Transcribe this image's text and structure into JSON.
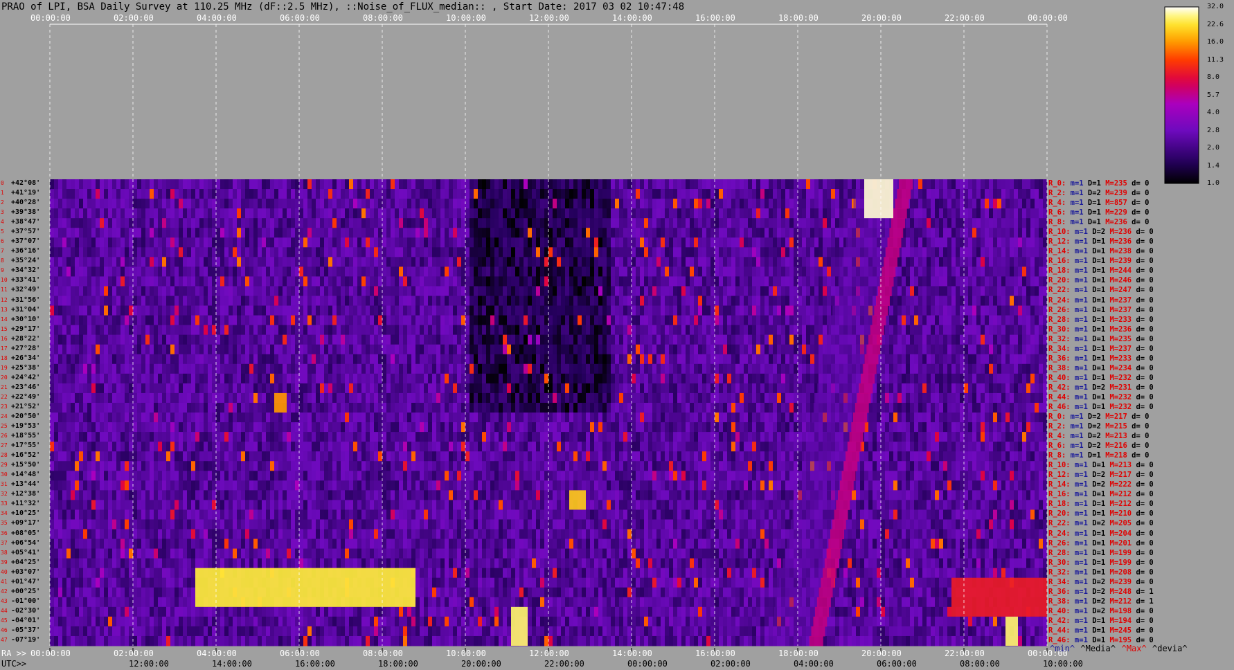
{
  "chart_data": {
    "type": "heatmap",
    "title": "PRAO of LPI, BSA Daily Survey at 110.25 MHz (dF::2.5 MHz), ::Noise_of_FLUX_median:: , Start Date: 2017 03 02 10:47:48",
    "top_ticks": [
      "00:00:00",
      "02:00:00",
      "04:00:00",
      "06:00:00",
      "08:00:00",
      "10:00:00",
      "12:00:00",
      "14:00:00",
      "16:00:00",
      "18:00:00",
      "20:00:00",
      "22:00:00",
      "00:00:00"
    ],
    "ra_label": "RA >>",
    "ra_ticks": [
      "00:00:00",
      "02:00:00",
      "04:00:00",
      "06:00:00",
      "08:00:00",
      "10:00:00",
      "12:00:00",
      "14:00:00",
      "16:00:00",
      "18:00:00",
      "20:00:00",
      "22:00:00",
      "00:00:00"
    ],
    "utc_label": "UTC>>",
    "utc_ticks": [
      "12:00:00",
      "14:00:00",
      "16:00:00",
      "18:00:00",
      "20:00:00",
      "22:00:00",
      "00:00:00",
      "02:00:00",
      "04:00:00",
      "06:00:00",
      "08:00:00",
      "10:00:00"
    ],
    "declinations": [
      "+42°08'",
      "+41°19'",
      "+40°28'",
      "+39°38'",
      "+38°47'",
      "+37°57'",
      "+37°07'",
      "+36°16'",
      "+35°24'",
      "+34°32'",
      "+33°41'",
      "+32°49'",
      "+31°56'",
      "+31°04'",
      "+30°10'",
      "+29°17'",
      "+28°22'",
      "+27°28'",
      "+26°34'",
      "+25°38'",
      "+24°42'",
      "+23°46'",
      "+22°49'",
      "+21°52'",
      "+20°50'",
      "+19°53'",
      "+18°55'",
      "+17°55'",
      "+16°52'",
      "+15°50'",
      "+14°48'",
      "+13°44'",
      "+12°38'",
      "+11°32'",
      "+10°25'",
      "+09°17'",
      "+08°05'",
      "+06°54'",
      "+05°41'",
      "+04°25'",
      "+03°07'",
      "+01°47'",
      "+00°25'",
      "-01°00'",
      "-02°30'",
      "-04°01'",
      "-05°37'",
      "-07°19'"
    ],
    "stats": [
      {
        "label": "R_0:",
        "m": "m=1",
        "D": "D=1",
        "M": "M=235",
        "d": "d= 0"
      },
      {
        "label": "R_2:",
        "m": "m=1",
        "D": "D=2",
        "M": "M=239",
        "d": "d= 0"
      },
      {
        "label": "R_4:",
        "m": "m=1",
        "D": "D=1",
        "M": "M=857",
        "d": "d= 0"
      },
      {
        "label": "R_6:",
        "m": "m=1",
        "D": "D=1",
        "M": "M=229",
        "d": "d= 0"
      },
      {
        "label": "R_8:",
        "m": "m=1",
        "D": "D=1",
        "M": "M=236",
        "d": "d= 0"
      },
      {
        "label": "R_10:",
        "m": "m=1",
        "D": "D=2",
        "M": "M=236",
        "d": "d= 0"
      },
      {
        "label": "R_12:",
        "m": "m=1",
        "D": "D=1",
        "M": "M=236",
        "d": "d= 0"
      },
      {
        "label": "R_14:",
        "m": "m=1",
        "D": "D=1",
        "M": "M=238",
        "d": "d= 0"
      },
      {
        "label": "R_16:",
        "m": "m=1",
        "D": "D=1",
        "M": "M=239",
        "d": "d= 0"
      },
      {
        "label": "R_18:",
        "m": "m=1",
        "D": "D=1",
        "M": "M=244",
        "d": "d= 0"
      },
      {
        "label": "R_20:",
        "m": "m=1",
        "D": "D=1",
        "M": "M=246",
        "d": "d= 0"
      },
      {
        "label": "R_22:",
        "m": "m=1",
        "D": "D=1",
        "M": "M=247",
        "d": "d= 0"
      },
      {
        "label": "R_24:",
        "m": "m=1",
        "D": "D=1",
        "M": "M=237",
        "d": "d= 0"
      },
      {
        "label": "R_26:",
        "m": "m=1",
        "D": "D=1",
        "M": "M=237",
        "d": "d= 0"
      },
      {
        "label": "R_28:",
        "m": "m=1",
        "D": "D=1",
        "M": "M=233",
        "d": "d= 0"
      },
      {
        "label": "R_30:",
        "m": "m=1",
        "D": "D=1",
        "M": "M=236",
        "d": "d= 0"
      },
      {
        "label": "R_32:",
        "m": "m=1",
        "D": "D=1",
        "M": "M=235",
        "d": "d= 0"
      },
      {
        "label": "R_34:",
        "m": "m=1",
        "D": "D=1",
        "M": "M=237",
        "d": "d= 0"
      },
      {
        "label": "R_36:",
        "m": "m=1",
        "D": "D=1",
        "M": "M=233",
        "d": "d= 0"
      },
      {
        "label": "R_38:",
        "m": "m=1",
        "D": "D=1",
        "M": "M=234",
        "d": "d= 0"
      },
      {
        "label": "R_40:",
        "m": "m=1",
        "D": "D=1",
        "M": "M=232",
        "d": "d= 0"
      },
      {
        "label": "R_42:",
        "m": "m=1",
        "D": "D=2",
        "M": "M=231",
        "d": "d= 0"
      },
      {
        "label": "R_44:",
        "m": "m=1",
        "D": "D=1",
        "M": "M=232",
        "d": "d= 0"
      },
      {
        "label": "R_46:",
        "m": "m=1",
        "D": "D=1",
        "M": "M=232",
        "d": "d= 0"
      },
      {
        "label": "R_0:",
        "m": "m=1",
        "D": "D=2",
        "M": "M=217",
        "d": "d= 0"
      },
      {
        "label": "R_2:",
        "m": "m=1",
        "D": "D=2",
        "M": "M=215",
        "d": "d= 0"
      },
      {
        "label": "R_4:",
        "m": "m=1",
        "D": "D=2",
        "M": "M=213",
        "d": "d= 0"
      },
      {
        "label": "R_6:",
        "m": "m=1",
        "D": "D=2",
        "M": "M=216",
        "d": "d= 0"
      },
      {
        "label": "R_8:",
        "m": "m=1",
        "D": "D=1",
        "M": "M=218",
        "d": "d= 0"
      },
      {
        "label": "R_10:",
        "m": "m=1",
        "D": "D=1",
        "M": "M=213",
        "d": "d= 0"
      },
      {
        "label": "R_12:",
        "m": "m=1",
        "D": "D=2",
        "M": "M=217",
        "d": "d= 0"
      },
      {
        "label": "R_14:",
        "m": "m=1",
        "D": "D=2",
        "M": "M=222",
        "d": "d= 0"
      },
      {
        "label": "R_16:",
        "m": "m=1",
        "D": "D=1",
        "M": "M=212",
        "d": "d= 0"
      },
      {
        "label": "R_18:",
        "m": "m=1",
        "D": "D=1",
        "M": "M=212",
        "d": "d= 0"
      },
      {
        "label": "R_20:",
        "m": "m=1",
        "D": "D=1",
        "M": "M=210",
        "d": "d= 0"
      },
      {
        "label": "R_22:",
        "m": "m=1",
        "D": "D=2",
        "M": "M=205",
        "d": "d= 0"
      },
      {
        "label": "R_24:",
        "m": "m=1",
        "D": "D=1",
        "M": "M=204",
        "d": "d= 0"
      },
      {
        "label": "R_26:",
        "m": "m=1",
        "D": "D=1",
        "M": "M=201",
        "d": "d= 0"
      },
      {
        "label": "R_28:",
        "m": "m=1",
        "D": "D=1",
        "M": "M=199",
        "d": "d= 0"
      },
      {
        "label": "R_30:",
        "m": "m=1",
        "D": "D=1",
        "M": "M=199",
        "d": "d= 0"
      },
      {
        "label": "R_32:",
        "m": "m=1",
        "D": "D=1",
        "M": "M=208",
        "d": "d= 0"
      },
      {
        "label": "R_34:",
        "m": "m=1",
        "D": "D=2",
        "M": "M=239",
        "d": "d= 0"
      },
      {
        "label": "R_36:",
        "m": "m=1",
        "D": "D=2",
        "M": "M=248",
        "d": "d= 1"
      },
      {
        "label": "R_38:",
        "m": "m=1",
        "D": "D=2",
        "M": "M=212",
        "d": "d= 1"
      },
      {
        "label": "R_40:",
        "m": "m=1",
        "D": "D=2",
        "M": "M=198",
        "d": "d= 0"
      },
      {
        "label": "R_42:",
        "m": "m=1",
        "D": "D=1",
        "M": "M=194",
        "d": "d= 0"
      },
      {
        "label": "R_44:",
        "m": "m=1",
        "D": "D=1",
        "M": "M=245",
        "d": "d= 0"
      },
      {
        "label": "R_46:",
        "m": "m=1",
        "D": "D=1",
        "M": "M=195",
        "d": "d= 0"
      }
    ],
    "legend_words": [
      {
        "text": "^min^",
        "color": "#1a1a9a"
      },
      {
        "text": "^Media^",
        "color": "#000000"
      },
      {
        "text": "^Max^",
        "color": "#e00000"
      },
      {
        "text": "^devia^",
        "color": "#000000"
      }
    ],
    "colorbar_ticks": [
      "32.0",
      "22.6",
      "16.0",
      "11.3",
      "8.0",
      "5.7",
      "4.0",
      "2.8",
      "2.0",
      "1.4",
      "1.0"
    ],
    "colorbar_range": [
      1.0,
      32.0
    ],
    "colorbar_scale": "log",
    "grid": true,
    "features": [
      {
        "ra_hours": [
          3.5,
          8.8
        ],
        "dec_rows": [
          40,
          43
        ],
        "level": 24
      },
      {
        "ra_hours": [
          21.7,
          24.0
        ],
        "dec_rows": [
          41,
          44
        ],
        "level": 9
      },
      {
        "ra_hours": [
          19.6,
          20.3
        ],
        "dec_rows": [
          0,
          3
        ],
        "level": 30
      },
      {
        "ra_hours": [
          11.1,
          11.5
        ],
        "dec_rows": [
          44,
          47
        ],
        "level": 26
      },
      {
        "ra_hours": [
          23.0,
          23.3
        ],
        "dec_rows": [
          45,
          47
        ],
        "level": 26
      },
      {
        "ra_hours": [
          12.5,
          12.9
        ],
        "dec_rows": [
          32,
          33
        ],
        "level": 20
      },
      {
        "ra_hours": [
          5.4,
          5.7
        ],
        "dec_rows": [
          22,
          23
        ],
        "level": 16
      }
    ],
    "drift_band": {
      "ra_start_hours": 18.4,
      "ra_end_hours": 20.6,
      "dec_rows": [
        0,
        47
      ],
      "level": 6
    }
  }
}
